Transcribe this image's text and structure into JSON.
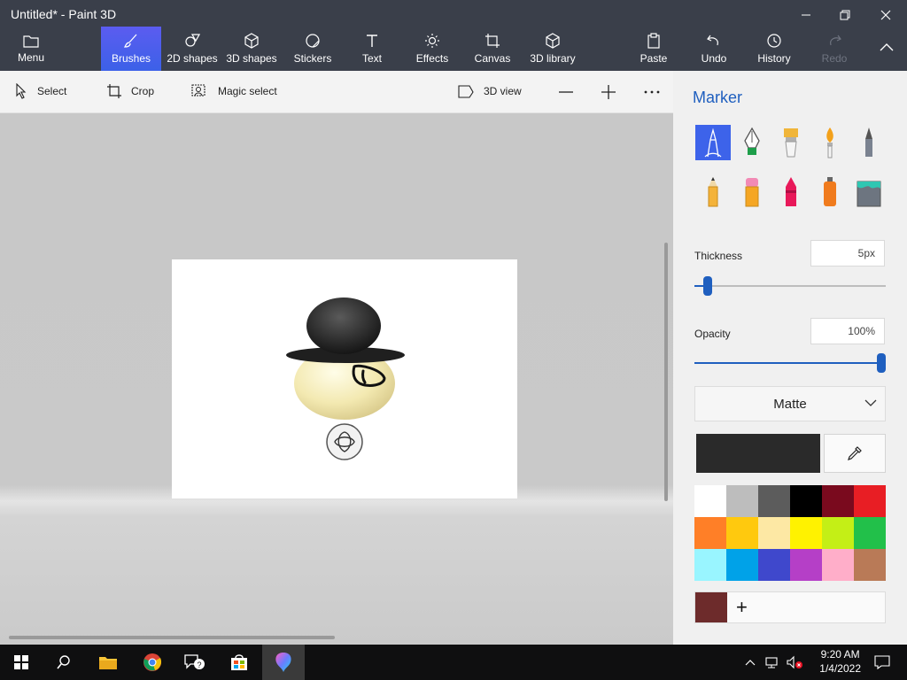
{
  "window": {
    "title": "Untitled* - Paint 3D"
  },
  "ribbon": {
    "menu": "Menu",
    "brushes": "Brushes",
    "shapes2d": "2D shapes",
    "shapes3d": "3D shapes",
    "stickers": "Stickers",
    "text": "Text",
    "effects": "Effects",
    "canvas": "Canvas",
    "library3d": "3D library",
    "paste": "Paste",
    "undo": "Undo",
    "history": "History",
    "redo": "Redo"
  },
  "toolbar": {
    "select": "Select",
    "crop": "Crop",
    "magic_select": "Magic select",
    "view3d": "3D view"
  },
  "panel": {
    "title": "Marker",
    "brushes": [
      "marker",
      "calligraphy-pen",
      "oil-brush",
      "watercolor",
      "pixel-pen",
      "pencil",
      "eraser",
      "crayon",
      "spray-can",
      "fill"
    ],
    "thickness_label": "Thickness",
    "thickness_value": "5px",
    "thickness_fraction": 0.05,
    "opacity_label": "Opacity",
    "opacity_value": "100%",
    "opacity_fraction": 1.0,
    "finish": "Matte",
    "current_color": "#2a2a2a",
    "palette": [
      "#ffffff",
      "#bdbdbd",
      "#5c5c5c",
      "#000000",
      "#7a0a1e",
      "#e81e24",
      "#ff7f27",
      "#ffc90e",
      "#fde8a4",
      "#fff200",
      "#c4ef16",
      "#22c04a",
      "#99f5ff",
      "#00a2e8",
      "#3f48cc",
      "#b53fc7",
      "#ffaec9",
      "#b97a57"
    ],
    "custom_color": "#6d2b2b"
  },
  "taskbar": {
    "time": "9:20 AM",
    "date": "1/4/2022"
  }
}
